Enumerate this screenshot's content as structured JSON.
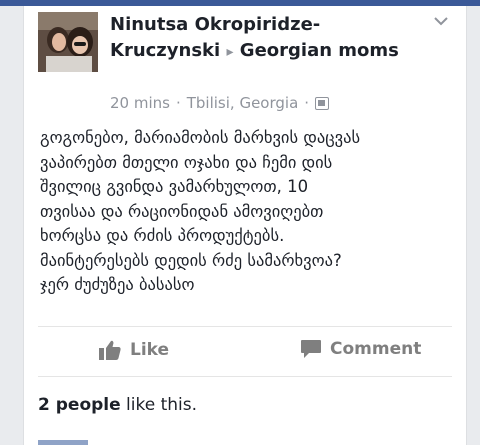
{
  "post": {
    "author": "Ninutsa Okropiridze-Kruczynski",
    "group_arrow": "▸",
    "group": "Georgian moms",
    "time": "20 mins",
    "separator": "·",
    "location": "Tbilisi, Georgia",
    "text": "გოგონებო, მარიამობის მარხვის დაცვას\nვაპირებთ მთელი ოჯახი და ჩემი დის\nშვილიც გვინდა ვამარხულოთ, 10\nთვისაა და რაციონიდან ამოვიღებთ\nხორცსა და რძის პროდუქტებს.\nმაინტერესებს დედის რძე სამარხვოა?\nჯერ ძუძუზეა ბასასო"
  },
  "actions": {
    "like_label": "Like",
    "comment_label": "Comment"
  },
  "likes": {
    "count_text": "2 people",
    "suffix": " like this."
  },
  "colors": {
    "brand": "#3b5998",
    "meta_gray": "#90949c",
    "action_gray": "#7f7f7f"
  }
}
